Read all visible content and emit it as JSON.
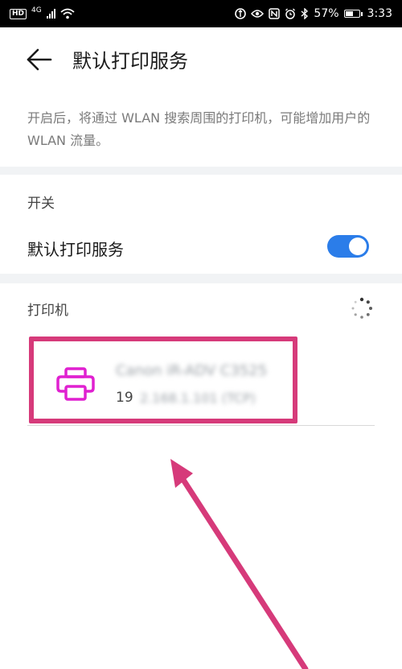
{
  "status_bar": {
    "hd_badge": "HD",
    "network": "4G",
    "battery_text": "57%",
    "battery_level": 0.57,
    "time": "3:33",
    "icons": [
      "wifi-icon",
      "data-saver-icon",
      "eye-icon",
      "nfc-icon",
      "alarm-icon",
      "bluetooth-icon",
      "battery-icon"
    ]
  },
  "header": {
    "back_icon": "arrow-left-icon",
    "title": "默认打印服务"
  },
  "description": "开启后，将通过 WLAN 搜索周围的打印机，可能增加用户的 WLAN 流量。",
  "switch_section": {
    "label": "开关",
    "row_label": "默认打印服务",
    "enabled": true
  },
  "printers_section": {
    "label": "打印机",
    "loading_icon": "spinner-icon",
    "items": [
      {
        "name": "Canon iR-ADV C3525",
        "ip_prefix": "19",
        "ip_rest": "2.168.1.101 (TCP)",
        "icon": "printer-icon"
      }
    ]
  },
  "colors": {
    "accent": "#2b7de9",
    "printer_icon": "#e020d0",
    "annotation": "#d63a7a",
    "band": "#f1f3f5"
  }
}
